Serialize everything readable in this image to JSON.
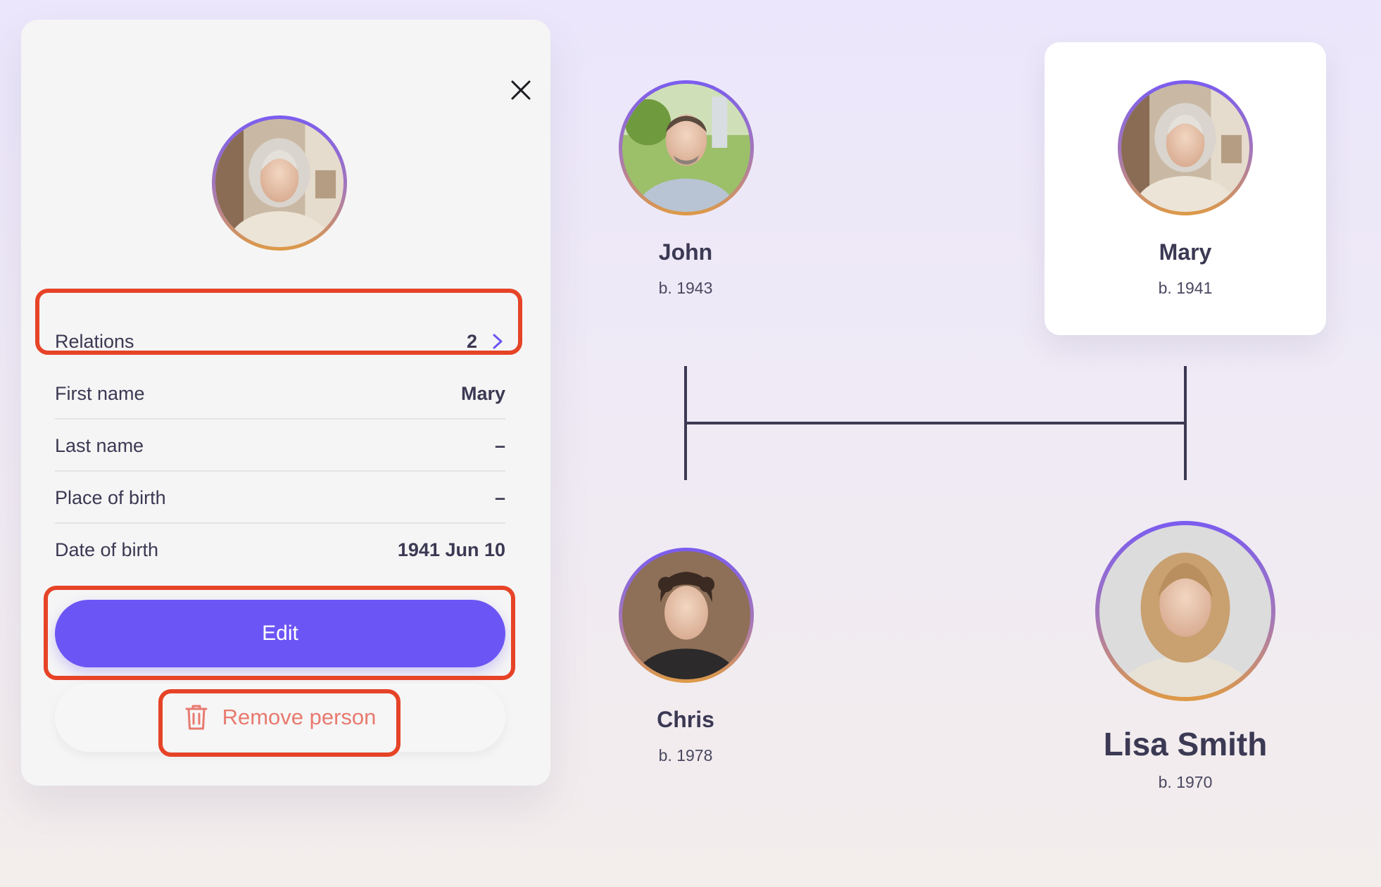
{
  "panel": {
    "close_label": "×",
    "relations": {
      "label": "Relations",
      "count": "2"
    },
    "fields": [
      {
        "label": "First name",
        "value": "Mary"
      },
      {
        "label": "Last name",
        "value": "–"
      },
      {
        "label": "Place of birth",
        "value": "–"
      },
      {
        "label": "Date of birth",
        "value": "1941 Jun 10"
      }
    ],
    "edit_label": "Edit",
    "remove_label": "Remove person"
  },
  "tree": {
    "people": [
      {
        "name": "John",
        "birth": "b. 1943"
      },
      {
        "name": "Mary",
        "birth": "b. 1941"
      },
      {
        "name": "Chris",
        "birth": "b. 1978"
      },
      {
        "name": "Lisa Smith",
        "birth": "b. 1970"
      }
    ]
  },
  "colors": {
    "accent": "#6c55f5",
    "danger": "#e87a6f",
    "highlight": "#e64327",
    "text": "#3b3953"
  },
  "icons": [
    "close-icon",
    "chevron-right-icon",
    "trash-icon"
  ]
}
